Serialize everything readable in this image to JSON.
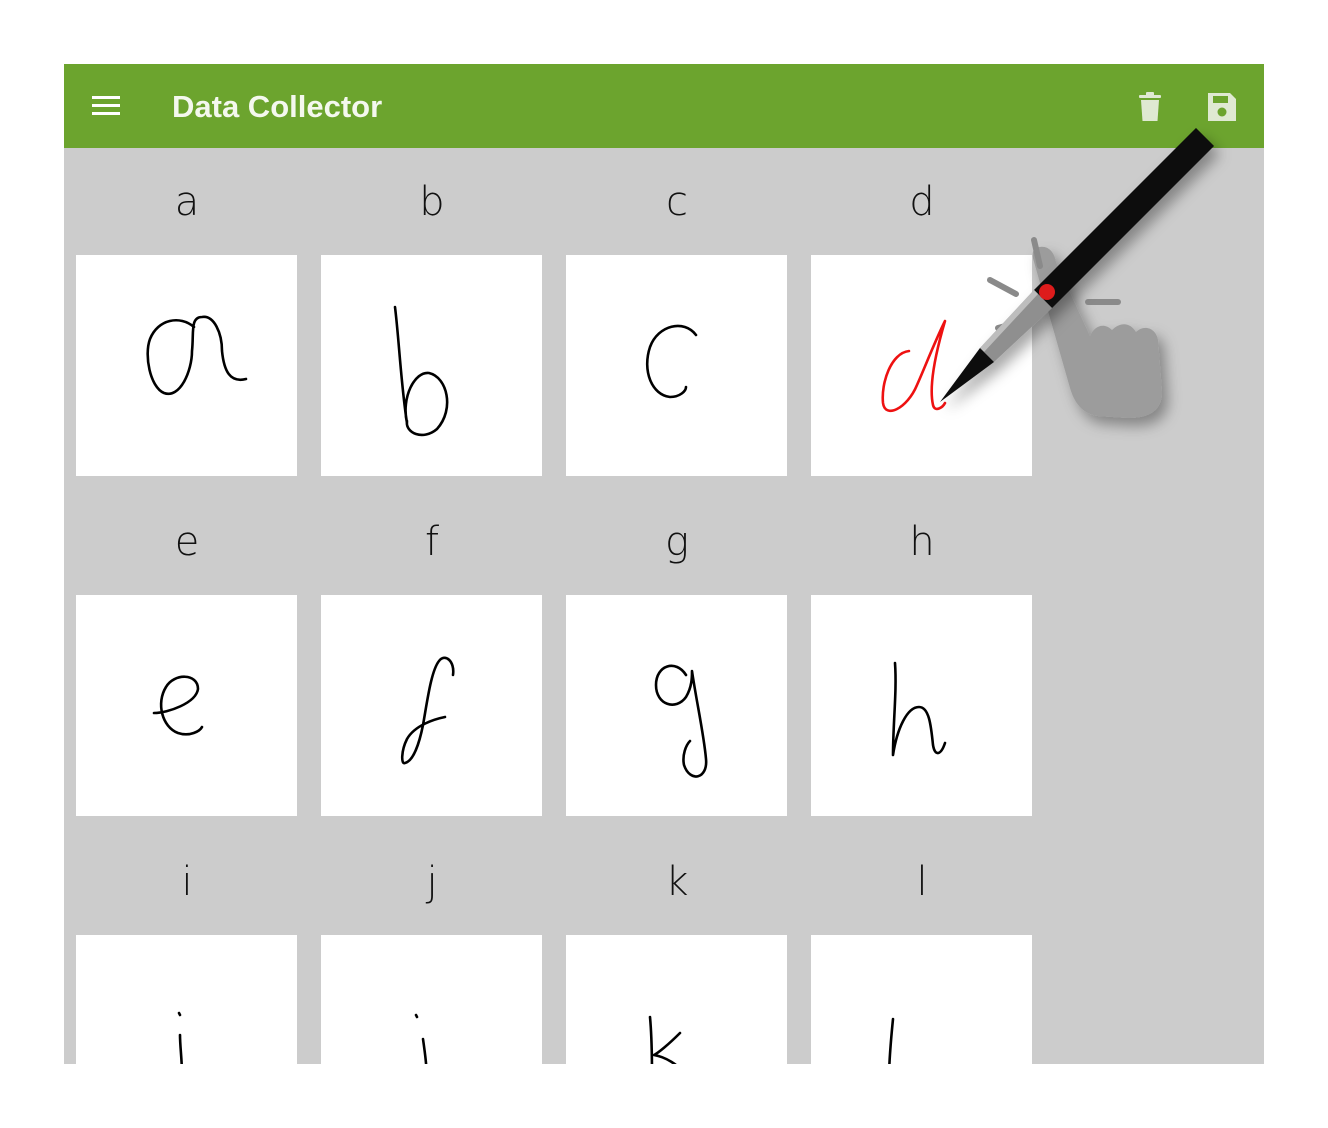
{
  "app": {
    "title": "Data Collector",
    "accent_color": "#6ca42e"
  },
  "toolbar": {
    "menu_icon": "menu-icon",
    "actions": [
      "delete-icon",
      "save-icon"
    ]
  },
  "grid": {
    "letters": [
      "a",
      "b",
      "c",
      "d",
      "e",
      "f",
      "g",
      "h",
      "i",
      "j",
      "k",
      "l"
    ],
    "active_letter": "d",
    "active_stroke_color": "#ee1111",
    "stroke_color": "#000000"
  },
  "overlay": {
    "icon": "stylus-touch-icon"
  }
}
